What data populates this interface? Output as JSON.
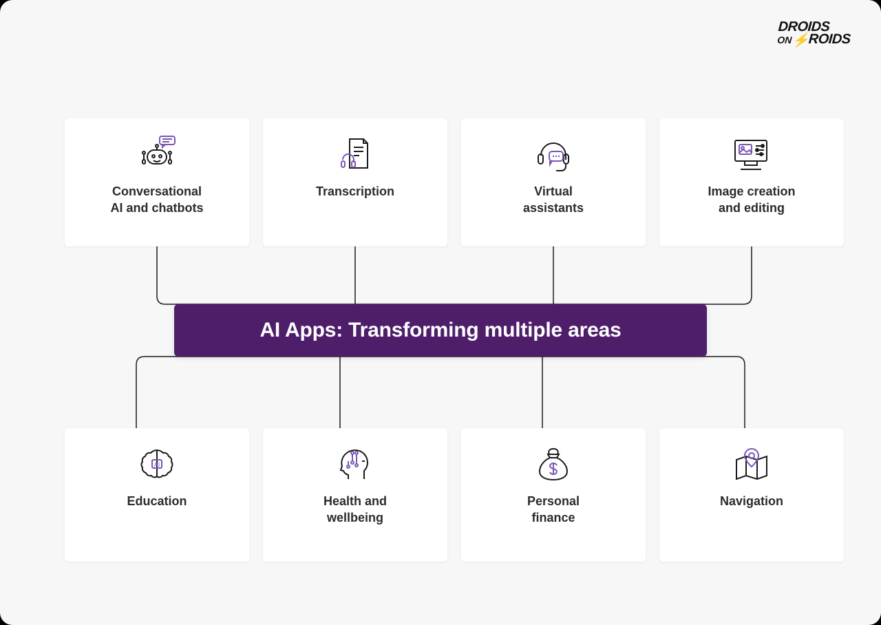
{
  "brand": {
    "line1": "DROIDS",
    "line2_prefix": "ON",
    "line2_main": "ROIDS"
  },
  "hub": {
    "title": "AI Apps: Transforming multiple areas"
  },
  "cards": {
    "top": [
      {
        "id": "conversational-ai",
        "label": "Conversational\nAI and chatbots",
        "icon": "chatbot-icon"
      },
      {
        "id": "transcription",
        "label": "Transcription",
        "icon": "transcription-icon"
      },
      {
        "id": "virtual-assistants",
        "label": "Virtual\nassistants",
        "icon": "headset-icon"
      },
      {
        "id": "image-creation",
        "label": "Image creation\nand editing",
        "icon": "image-editor-icon"
      }
    ],
    "bottom": [
      {
        "id": "education",
        "label": "Education",
        "icon": "brain-ai-icon"
      },
      {
        "id": "health-wellbeing",
        "label": "Health and\nwellbeing",
        "icon": "head-circuit-icon"
      },
      {
        "id": "personal-finance",
        "label": "Personal\nfinance",
        "icon": "money-bag-icon"
      },
      {
        "id": "navigation",
        "label": "Navigation",
        "icon": "map-pin-icon"
      }
    ]
  },
  "colors": {
    "accent": "#7a55b5",
    "hub_bg": "#4e1e6b",
    "text": "#2b2b2b",
    "page_bg": "#f7f7f7",
    "line": "#1a1a1a"
  }
}
